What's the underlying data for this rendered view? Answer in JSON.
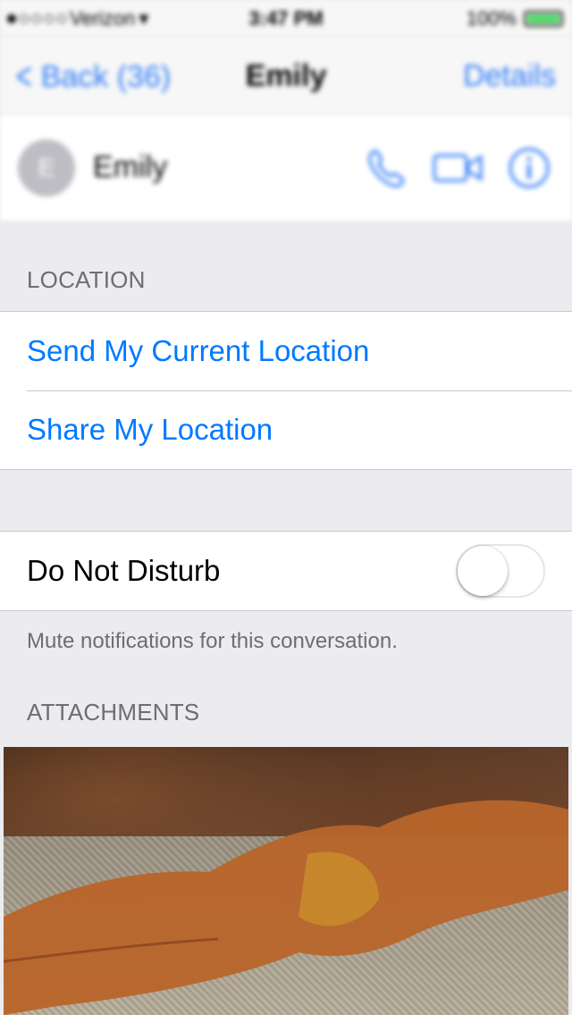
{
  "status_bar": {
    "carrier": "Verizon",
    "time": "3:47 PM",
    "battery": "100%"
  },
  "nav": {
    "back_label": "Back (36)",
    "title": "Emily",
    "details_label": "Details"
  },
  "contact": {
    "avatar_initial": "E",
    "name": "Emily",
    "actions": [
      "phone-icon",
      "video-icon",
      "info-icon"
    ]
  },
  "location_section": {
    "header": "LOCATION",
    "items": [
      {
        "label": "Send My Current Location"
      },
      {
        "label": "Share My Location"
      }
    ]
  },
  "dnd": {
    "label": "Do Not Disturb",
    "enabled": false,
    "footer": "Mute notifications for this conversation."
  },
  "attachments_section": {
    "header": "ATTACHMENTS"
  },
  "colors": {
    "accent": "#007aff",
    "section_text": "#6d6d72",
    "background": "#ebebf0"
  }
}
